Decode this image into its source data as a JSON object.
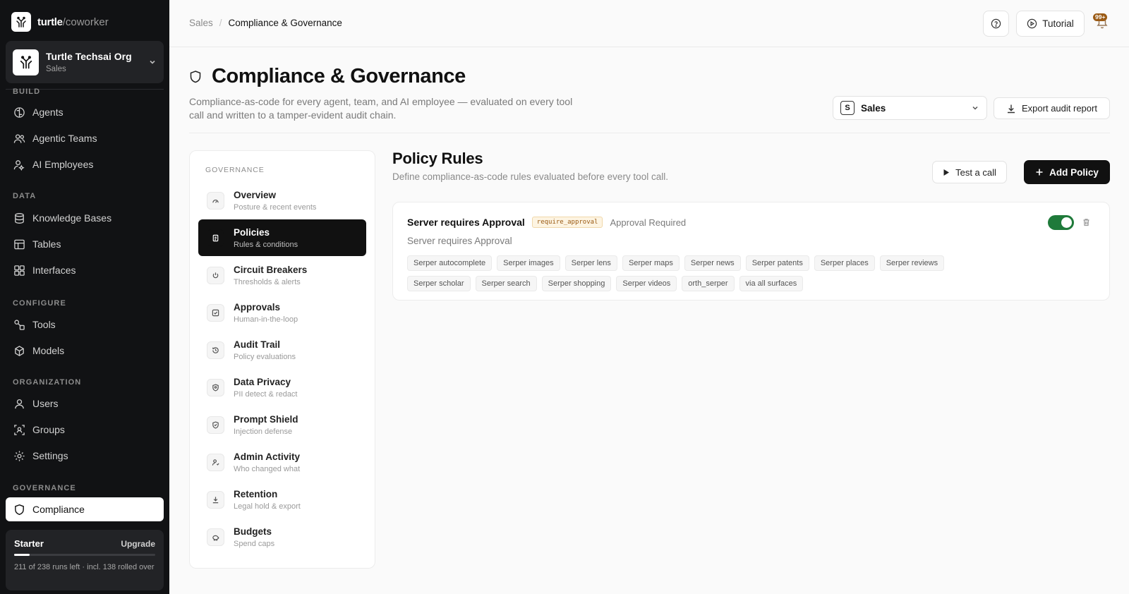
{
  "brand": {
    "name": "turtle",
    "suffix": "/coworker"
  },
  "org": {
    "name": "Turtle Techsai Org",
    "sub": "Sales"
  },
  "sidebar": {
    "sections": [
      {
        "label": "BUILD"
      },
      {
        "label": "DATA"
      },
      {
        "label": "CONFIGURE"
      },
      {
        "label": "ORGANIZATION"
      },
      {
        "label": "GOVERNANCE"
      }
    ],
    "items": [
      {
        "label": "Agents",
        "icon": "brain-icon"
      },
      {
        "label": "Agentic Teams",
        "icon": "team-icon"
      },
      {
        "label": "AI Employees",
        "icon": "user-ai-icon"
      },
      {
        "label": "Knowledge Bases",
        "icon": "database-icon"
      },
      {
        "label": "Tables",
        "icon": "table-icon"
      },
      {
        "label": "Interfaces",
        "icon": "grid-icon"
      },
      {
        "label": "Tools",
        "icon": "tools-icon"
      },
      {
        "label": "Models",
        "icon": "model-icon"
      },
      {
        "label": "Users",
        "icon": "user-icon"
      },
      {
        "label": "Groups",
        "icon": "groups-icon"
      },
      {
        "label": "Settings",
        "icon": "gear-icon"
      },
      {
        "label": "Compliance",
        "icon": "shield-icon",
        "active": true
      }
    ]
  },
  "plan": {
    "name": "Starter",
    "upgrade": "Upgrade",
    "note": "211 of 238 runs left · incl. 138 rolled over",
    "used_fraction": 0.11
  },
  "topbar": {
    "breadcrumb": [
      "Sales",
      "Compliance & Governance"
    ],
    "tutorial": "Tutorial",
    "notifications": "99+"
  },
  "header": {
    "title": "Compliance & Governance",
    "description": "Compliance-as-code for every agent, team, and AI employee — evaluated on every tool call and written to a tamper-evident audit chain.",
    "scope_badge": "S",
    "scope_value": "Sales",
    "export_label": "Export audit report"
  },
  "governance_nav": {
    "heading": "GOVERNANCE",
    "items": [
      {
        "label": "Overview",
        "sub": "Posture & recent events",
        "icon": "gauge-icon"
      },
      {
        "label": "Policies",
        "sub": "Rules & conditions",
        "icon": "document-icon",
        "active": true
      },
      {
        "label": "Circuit Breakers",
        "sub": "Thresholds & alerts",
        "icon": "power-icon"
      },
      {
        "label": "Approvals",
        "sub": "Human-in-the-loop",
        "icon": "check-square-icon"
      },
      {
        "label": "Audit Trail",
        "sub": "Policy evaluations",
        "icon": "history-icon"
      },
      {
        "label": "Data Privacy",
        "sub": "PII detect & redact",
        "icon": "privacy-icon"
      },
      {
        "label": "Prompt Shield",
        "sub": "Injection defense",
        "icon": "shield-check-icon"
      },
      {
        "label": "Admin Activity",
        "sub": "Who changed what",
        "icon": "user-activity-icon"
      },
      {
        "label": "Retention",
        "sub": "Legal hold & export",
        "icon": "archive-icon"
      },
      {
        "label": "Budgets",
        "sub": "Spend caps",
        "icon": "piggy-bank-icon"
      }
    ]
  },
  "policy_rules": {
    "title": "Policy Rules",
    "description": "Define compliance-as-code rules evaluated before every tool call.",
    "test_label": "Test a call",
    "add_label": "Add Policy",
    "policies": [
      {
        "name": "Server requires Approval",
        "tag": "require_approval",
        "mode": "Approval Required",
        "description": "Server requires Approval",
        "enabled": true,
        "chips": [
          "Serper autocomplete",
          "Serper images",
          "Serper lens",
          "Serper maps",
          "Serper news",
          "Serper patents",
          "Serper places",
          "Serper reviews",
          "Serper scholar",
          "Serper search",
          "Serper shopping",
          "Serper videos",
          "orth_serper",
          "via all surfaces"
        ]
      }
    ]
  },
  "colors": {
    "accent": "#111111",
    "toggle_on": "#1f7a3a",
    "tag_text": "#9a5a14",
    "tag_bg": "#fdf4e2"
  }
}
